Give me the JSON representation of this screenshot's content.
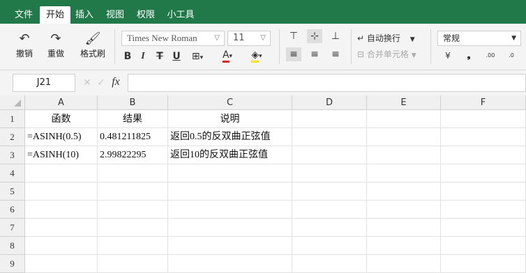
{
  "menu": [
    "文件",
    "开始",
    "插入",
    "视图",
    "权限",
    "小工具"
  ],
  "toolbar": {
    "undo": "撤销",
    "redo": "重做",
    "format_painter": "格式刷",
    "font_name": "Times New Roman",
    "font_size": "11",
    "wrap_text": "自动换行",
    "merge_cells": "合并单元格",
    "number_format": "常规",
    "bold": "B",
    "italic": "I",
    "strike": "T",
    "underline": "U",
    "font_color_letter": "A",
    "font_color": "#e02020",
    "fill_color": "#f5e600"
  },
  "formula_bar": {
    "cell_ref": "J21",
    "fx": "fx",
    "formula": ""
  },
  "columns": [
    "A",
    "B",
    "C",
    "D",
    "E",
    "F"
  ],
  "rows": [
    "1",
    "2",
    "3",
    "4",
    "5",
    "6",
    "7",
    "8",
    "9"
  ],
  "cells": {
    "r1": [
      "函数",
      "结果",
      "说明"
    ],
    "r2": [
      "=ASINH(0.5)",
      "0.481211825",
      "返回0.5的反双曲正弦值"
    ],
    "r3": [
      "=ASINH(10)",
      "2.99822295",
      "返回10的反双曲正弦值"
    ]
  }
}
